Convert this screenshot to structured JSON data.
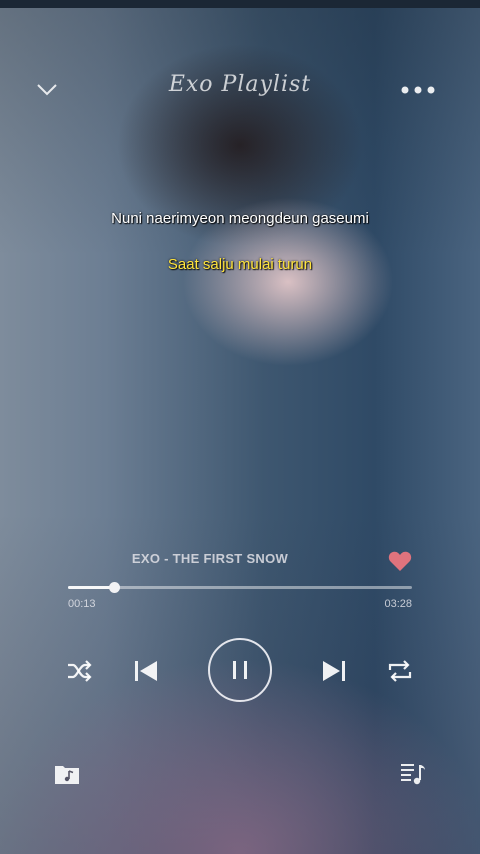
{
  "app": {
    "title": "Exo Playlist"
  },
  "lyrics": {
    "line": "Nuni naerimyeon meongdeun gaseumi",
    "translation": "Saat salju mulai turun"
  },
  "track": {
    "display_title": "EXO -  THE FIRST SNOW",
    "favorited": true,
    "progress_fraction": 0.135
  },
  "time": {
    "elapsed": "00:13",
    "total": "03:28"
  },
  "playback": {
    "state": "playing"
  },
  "icons": {
    "collapse": "chevron-down-icon",
    "more": "more-dots-icon",
    "favorite": "heart-icon",
    "shuffle": "shuffle-icon",
    "previous": "skip-previous-icon",
    "pause": "pause-icon",
    "next": "skip-next-icon",
    "repeat": "repeat-icon",
    "library": "music-folder-icon",
    "queue": "playlist-icon"
  },
  "colors": {
    "lyric_primary": "#ffffff",
    "lyric_translation": "#ffe43c",
    "heart": "#e0737d"
  }
}
